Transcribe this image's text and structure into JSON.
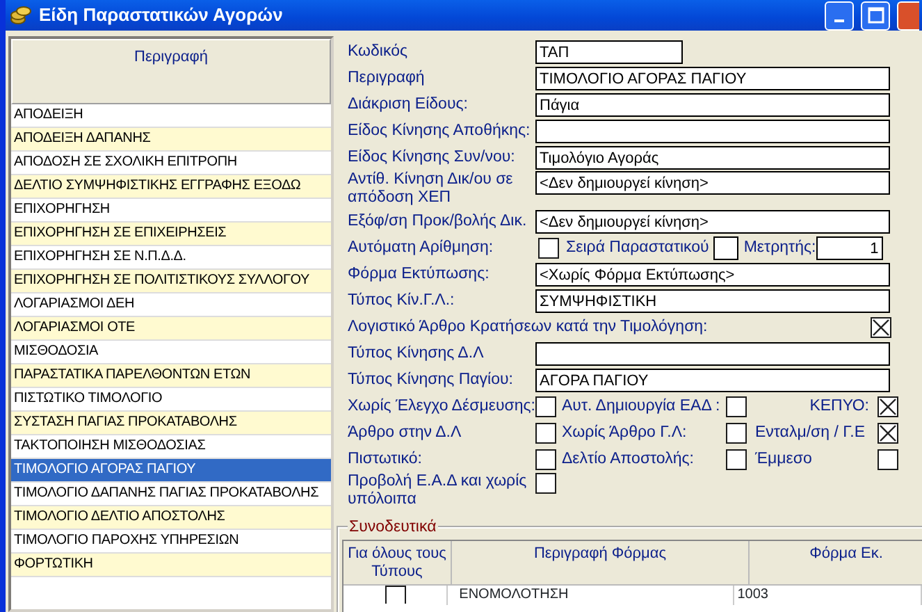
{
  "window": {
    "title": "Είδη Παραστατικών Αγορών"
  },
  "list": {
    "header": "Περιγραφή",
    "items": [
      {
        "text": "ΑΠΟΔΕΙΞΗ",
        "selected": false
      },
      {
        "text": "ΑΠΟΔΕΙΞΗ ΔΑΠΑΝΗΣ",
        "selected": false
      },
      {
        "text": "ΑΠΟΔΟΣΗ ΣΕ ΣΧΟΛΙΚΗ ΕΠΙΤΡΟΠΗ",
        "selected": false
      },
      {
        "text": "ΔΕΛΤΙΟ ΣΥΜΨΗΦΙΣΤΙΚΗΣ ΕΓΓΡΑΦΗΣ ΕΞΟΔΩ",
        "selected": false
      },
      {
        "text": "ΕΠΙΧΟΡΗΓΗΣΗ",
        "selected": false
      },
      {
        "text": "ΕΠΙΧΟΡΗΓΗΣΗ ΣΕ ΕΠΙΧΕΙΡΗΣΕΙΣ",
        "selected": false
      },
      {
        "text": "ΕΠΙΧΟΡΗΓΗΣΗ ΣΕ Ν.Π.Δ.Δ.",
        "selected": false
      },
      {
        "text": "ΕΠΙΧΟΡΗΓΗΣΗ ΣΕ ΠΟΛΙΤΙΣΤΙΚΟΥΣ ΣΥΛΛΟΓΟΥ",
        "selected": false
      },
      {
        "text": "ΛΟΓΑΡΙΑΣΜΟΙ ΔΕΗ",
        "selected": false
      },
      {
        "text": "ΛΟΓΑΡΙΑΣΜΟΙ ΟΤΕ",
        "selected": false
      },
      {
        "text": "ΜΙΣΘΟΔΟΣΙΑ",
        "selected": false
      },
      {
        "text": "ΠΑΡΑΣΤΑΤΙΚΑ ΠΑΡΕΛΘΟΝΤΩΝ ΕΤΩΝ",
        "selected": false
      },
      {
        "text": "ΠΙΣΤΩΤΙΚΟ ΤΙΜΟΛΟΓΙΟ",
        "selected": false
      },
      {
        "text": "ΣΥΣΤΑΣΗ ΠΑΓΙΑΣ ΠΡΟΚΑΤΑΒΟΛΗΣ",
        "selected": false
      },
      {
        "text": "ΤΑΚΤΟΠΟΙΗΣΗ ΜΙΣΘΟΔΟΣΙΑΣ",
        "selected": false
      },
      {
        "text": "ΤΙΜΟΛΟΓΙΟ ΑΓΟΡΑΣ ΠΑΓΙΟΥ",
        "selected": true
      },
      {
        "text": "ΤΙΜΟΛΟΓΙΟ ΔΑΠΑΝΗΣ ΠΑΓΙΑΣ ΠΡΟΚΑΤΑΒΟΛΗΣ",
        "selected": false
      },
      {
        "text": "ΤΙΜΟΛΟΓΙΟ ΔΕΛΤΙΟ ΑΠΟΣΤΟΛΗΣ",
        "selected": false
      },
      {
        "text": "ΤΙΜΟΛΟΓΙΟ ΠΑΡΟΧΗΣ ΥΠΗΡΕΣΙΩΝ",
        "selected": false
      },
      {
        "text": "ΦΟΡΤΩΤΙΚΗ",
        "selected": false
      }
    ]
  },
  "form": {
    "fields": [
      {
        "kind": "short",
        "label": "Κωδικός",
        "value": "ΤΑΠ"
      },
      {
        "kind": "text",
        "label": "Περιγραφή",
        "value": "ΤΙΜΟΛΟΓΙΟ ΑΓΟΡΑΣ ΠΑΓΙΟΥ"
      },
      {
        "kind": "text",
        "label": "Διάκριση Είδους:",
        "value": "Πάγια"
      },
      {
        "kind": "text",
        "label": "Είδος Κίνησης Αποθήκης:"
      },
      {
        "kind": "text",
        "label": "Είδος Κίνησης Συν/νου:",
        "value": "Τιμολόγιο Αγοράς"
      },
      {
        "kind": "tall",
        "label": "Αντίθ. Κίνηση Δικ/ου σε απόδοση ΧΕΠ",
        "value": "<Δεν δημιουργεί κίνηση>"
      },
      {
        "kind": "text",
        "label": "Εξόφ/ση Προκ/βολής Δικ.",
        "value": "<Δεν δημιουργεί κίνηση>"
      },
      {
        "kind": "numbering",
        "label": "Αυτόματη Αρίθμηση:",
        "checked": false,
        "series_label": "Σειρά Παραστατικού",
        "counter_label": "Μετρητής:",
        "counter_value": "1"
      },
      {
        "kind": "text",
        "label": "Φόρμα Εκτύπωσης:",
        "value": "<Χωρίς Φόρμα Εκτύπωσης>"
      },
      {
        "kind": "text",
        "label": "Τύπος Κίν.Γ.Λ.:",
        "value": "ΣΥΜΨΗΦΙΣΤΙΚΗ"
      },
      {
        "kind": "check_row",
        "label": "Λογιστικό Άρθρο Κρατήσεων κατά την Τιμολόγηση:",
        "checked": true
      },
      {
        "kind": "text",
        "label": "Τύπος Κίνησης Δ.Λ"
      },
      {
        "kind": "text",
        "label": "Τύπος Κίνησης Παγίου:",
        "value": "ΑΓΟΡΑ ΠΑΓΙΟΥ"
      }
    ],
    "checks": [
      [
        {
          "label": "Χωρίς Έλεγχο Δέσμευσης:",
          "checked": false
        },
        {
          "label": "Αυτ. Δημιουργία ΕΑΔ :",
          "checked": false
        },
        {
          "label": "ΚΕΠΥΟ:",
          "checked": true
        }
      ],
      [
        {
          "label": "Άρθρο στην Δ.Λ",
          "checked": false
        },
        {
          "label": "Χωρίς  Άρθρο Γ.Λ:",
          "checked": false
        },
        {
          "label": "Ενταλμ/ση / Γ.Ε",
          "checked": true
        }
      ],
      [
        {
          "label": "Πιστωτικό:",
          "checked": false
        },
        {
          "label": "Δελτίο Αποστολής:",
          "checked": false
        },
        {
          "label": "Έμμεσο",
          "checked": false
        }
      ],
      [
        {
          "label": "Προβολή  Ε.Α.Δ και χωρίς υπόλοιπα",
          "checked": false
        }
      ]
    ]
  },
  "attachments": {
    "title": "Συνοδευτικά",
    "columns": [
      "Για όλους τους Τύπους",
      "Περιγραφή Φόρμας",
      "Φόρμα Εκ."
    ],
    "rows": [
      {
        "checked": false,
        "description": "ΕΝΟΜΟΛΟΤΗΣΗ",
        "form": "1003"
      }
    ]
  }
}
